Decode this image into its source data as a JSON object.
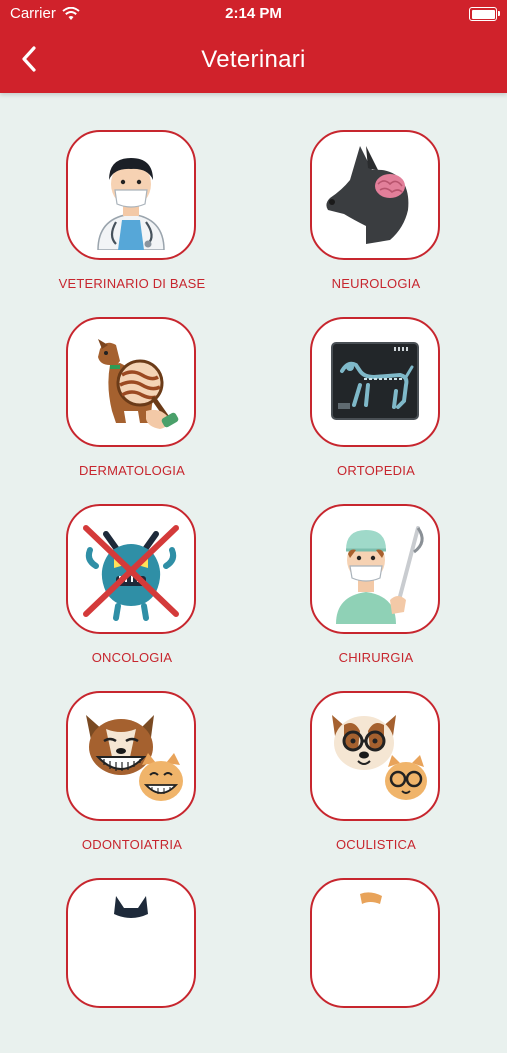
{
  "status": {
    "carrier": "Carrier",
    "time": "2:14 PM"
  },
  "header": {
    "title": "Veterinari",
    "back_icon": "chevron-left-icon"
  },
  "colors": {
    "brand": "#d0222b",
    "background": "#e9f1ee",
    "tile_border": "#c7262e",
    "label": "#c7262e"
  },
  "categories": [
    {
      "label": "VETERINARIO DI BASE",
      "icon": "veterinarian-icon"
    },
    {
      "label": "NEUROLOGIA",
      "icon": "dog-brain-icon"
    },
    {
      "label": "DERMATOLOGIA",
      "icon": "dog-skin-magnifier-icon"
    },
    {
      "label": "ORTOPEDIA",
      "icon": "dog-xray-icon"
    },
    {
      "label": "ONCOLOGIA",
      "icon": "crossed-monster-icon"
    },
    {
      "label": "CHIRURGIA",
      "icon": "surgeon-icon"
    },
    {
      "label": "ODONTOIATRIA",
      "icon": "smiling-dog-cat-icon"
    },
    {
      "label": "OCULISTICA",
      "icon": "dog-cat-glasses-icon"
    },
    {
      "label": "",
      "icon": "cat-icon"
    },
    {
      "label": "",
      "icon": "animal-icon"
    }
  ]
}
